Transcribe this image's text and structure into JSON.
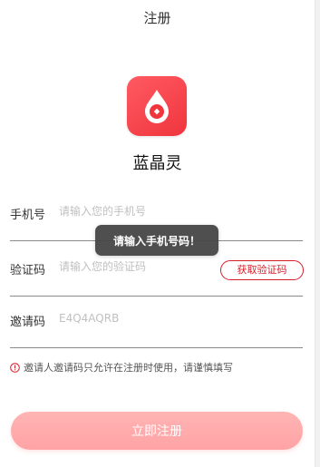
{
  "header": {
    "title": "注册"
  },
  "app": {
    "logo_icon": "blood-drop-icon",
    "name": "蓝晶灵",
    "brand_color": "#f0353d"
  },
  "form": {
    "phone": {
      "label": "手机号",
      "placeholder": "请输入您的手机号",
      "value": ""
    },
    "code": {
      "label": "验证码",
      "placeholder": "请输入您的验证码",
      "value": "",
      "get_code_label": "获取验证码"
    },
    "invite": {
      "label": "邀请码",
      "placeholder": "E4Q4AQRB",
      "value": ""
    },
    "notice": {
      "icon": "info-circle-icon",
      "text": "邀请人邀请码只允许在注册时使用，请谨慎填写"
    },
    "submit_label": "立即注册"
  },
  "toast": {
    "message": "请输入手机号码！"
  },
  "colors": {
    "accent": "#d81e2b",
    "submit_bg": "#ffa8aa",
    "toast_bg": "#484848",
    "divider": "#8a8a8a"
  }
}
